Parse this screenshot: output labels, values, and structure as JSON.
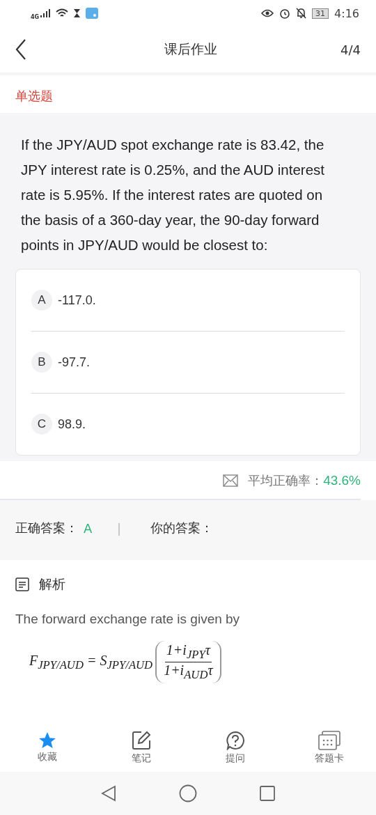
{
  "status_bar": {
    "network": "4G",
    "battery": "31",
    "time": "4:16"
  },
  "header": {
    "title": "课后作业",
    "progress": "4/4"
  },
  "question_type": "单选题",
  "question": "If the JPY/AUD spot exchange rate is 83.42, the JPY interest rate is 0.25%, and the AUD interest rate is 5.95%. If the interest rates are quoted on the basis of a 360-day year, the 90-day forward points in JPY/AUD would be closest to:",
  "options": [
    {
      "letter": "A",
      "text": "-117.0."
    },
    {
      "letter": "B",
      "text": "-97.7."
    },
    {
      "letter": "C",
      "text": "98.9."
    }
  ],
  "stats": {
    "label": "平均正确率：",
    "value": "43.6%"
  },
  "answers": {
    "correct_label": "正确答案：",
    "correct": "A",
    "separator": "|",
    "yours_label": "你的答案："
  },
  "analysis": {
    "title": "解析",
    "text": "The forward exchange rate is given by",
    "formula": {
      "lhs": "F$_{JPY/AUD}$ = S$_{JPY/AUD}$",
      "numerator": "1+i$_{JPY}$τ",
      "denominator": "1+i$_{AUD}$τ"
    }
  },
  "tab_bar": [
    {
      "label": "收藏",
      "kind": "star",
      "selected": true
    },
    {
      "label": "笔记",
      "kind": "note",
      "selected": false
    },
    {
      "label": "提问",
      "kind": "question",
      "selected": false
    },
    {
      "label": "答题卡",
      "kind": "card",
      "selected": false
    }
  ]
}
